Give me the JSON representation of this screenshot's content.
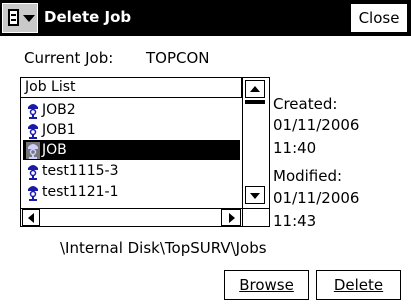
{
  "window": {
    "title": "Delete Job",
    "close_label": "Close"
  },
  "current_job": {
    "label": "Current Job:",
    "value": "TOPCON"
  },
  "job_list": {
    "header": "Job List",
    "items": [
      {
        "name": "JOB2",
        "selected": false
      },
      {
        "name": "JOB1",
        "selected": false
      },
      {
        "name": "JOB",
        "selected": true
      },
      {
        "name": "test1115-3",
        "selected": false
      },
      {
        "name": "test1121-1",
        "selected": false
      }
    ]
  },
  "details": {
    "created_label": "Created:",
    "created_date": "01/11/2006",
    "created_time": "11:40",
    "modified_label": "Modified:",
    "modified_date": "01/11/2006",
    "modified_time": "11:43"
  },
  "path": "\\Internal Disk\\TopSURV\\Jobs",
  "buttons": {
    "browse_label": "Browse",
    "delete_label": "Delete"
  },
  "colors": {
    "titlebar": "#000000",
    "selection": "#000000",
    "icon_blue": "#1a1aa8"
  }
}
